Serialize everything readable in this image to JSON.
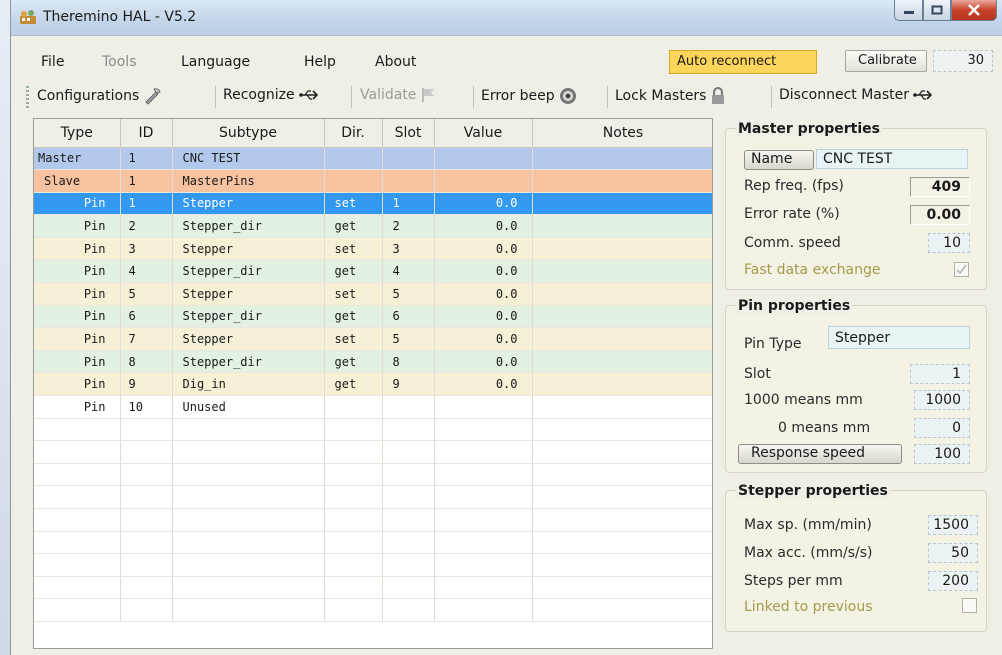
{
  "window": {
    "title": "Theremino HAL - V5.2"
  },
  "menu": {
    "file": "File",
    "tools": "Tools",
    "language": "Language",
    "help": "Help",
    "about": "About"
  },
  "top_right": {
    "auto_reconnect": "Auto reconnect",
    "calibrate": "Calibrate",
    "calibrate_value": "30"
  },
  "toolbar": {
    "configurations": "Configurations",
    "recognize": "Recognize",
    "validate": "Validate",
    "error_beep": "Error beep",
    "lock_masters": "Lock Masters",
    "disconnect_master": "Disconnect Master"
  },
  "grid": {
    "columns": [
      "Type",
      "ID",
      "Subtype",
      "Dir.",
      "Slot",
      "Value",
      "Notes"
    ],
    "rows": [
      {
        "type": "Master",
        "id": "1",
        "subtype": "CNC TEST",
        "dir": "",
        "slot": "",
        "value": "",
        "notes": "",
        "style": "master"
      },
      {
        "type": "Slave",
        "id": "1",
        "subtype": "MasterPins",
        "dir": "",
        "slot": "",
        "value": "",
        "notes": "",
        "style": "slave"
      },
      {
        "type": "Pin",
        "id": "1",
        "subtype": "Stepper",
        "dir": "set",
        "slot": "1",
        "value": "0.0",
        "notes": "",
        "style": "selected"
      },
      {
        "type": "Pin",
        "id": "2",
        "subtype": "Stepper_dir",
        "dir": "get",
        "slot": "2",
        "value": "0.0",
        "notes": "",
        "style": "alt-a"
      },
      {
        "type": "Pin",
        "id": "3",
        "subtype": "Stepper",
        "dir": "set",
        "slot": "3",
        "value": "0.0",
        "notes": "",
        "style": "alt-b"
      },
      {
        "type": "Pin",
        "id": "4",
        "subtype": "Stepper_dir",
        "dir": "get",
        "slot": "4",
        "value": "0.0",
        "notes": "",
        "style": "alt-a"
      },
      {
        "type": "Pin",
        "id": "5",
        "subtype": "Stepper",
        "dir": "set",
        "slot": "5",
        "value": "0.0",
        "notes": "",
        "style": "alt-b"
      },
      {
        "type": "Pin",
        "id": "6",
        "subtype": "Stepper_dir",
        "dir": "get",
        "slot": "6",
        "value": "0.0",
        "notes": "",
        "style": "alt-a"
      },
      {
        "type": "Pin",
        "id": "7",
        "subtype": "Stepper",
        "dir": "set",
        "slot": "5",
        "value": "0.0",
        "notes": "",
        "style": "alt-b"
      },
      {
        "type": "Pin",
        "id": "8",
        "subtype": "Stepper_dir",
        "dir": "get",
        "slot": "8",
        "value": "0.0",
        "notes": "",
        "style": "alt-a"
      },
      {
        "type": "Pin",
        "id": "9",
        "subtype": "Dig_in",
        "dir": "get",
        "slot": "9",
        "value": "0.0",
        "notes": "",
        "style": "alt-b"
      },
      {
        "type": "Pin",
        "id": "10",
        "subtype": "Unused",
        "dir": "",
        "slot": "",
        "value": "",
        "notes": "",
        "style": "empty"
      }
    ]
  },
  "master_props": {
    "title": "Master properties",
    "name_button": "Name",
    "name_value": "CNC TEST",
    "rep_freq_label": "Rep freq. (fps)",
    "rep_freq_value": "409",
    "error_rate_label": "Error rate (%)",
    "error_rate_value": "0.00",
    "comm_speed_label": "Comm. speed",
    "comm_speed_value": "10",
    "fast_exchange_label": "Fast data exchange",
    "fast_exchange_checked": true
  },
  "pin_props": {
    "title": "Pin properties",
    "pin_type_label": "Pin Type",
    "pin_type_value": "Stepper",
    "slot_label": "Slot",
    "slot_value": "1",
    "means_1000_label": "1000 means mm",
    "means_1000_value": "1000",
    "means_0_label": "0 means mm",
    "means_0_value": "0",
    "response_speed_button": "Response speed",
    "response_speed_value": "100"
  },
  "stepper_props": {
    "title": "Stepper properties",
    "max_speed_label": "Max sp. (mm/min)",
    "max_speed_value": "1500",
    "max_acc_label": "Max acc. (mm/s/s)",
    "max_acc_value": "50",
    "steps_per_mm_label": "Steps per mm",
    "steps_per_mm_value": "200",
    "linked_label": "Linked to previous",
    "linked_checked": false
  },
  "colors": {
    "master_row": "#b3c9ec",
    "slave_row": "#f7c2a0",
    "selected_row": "#3399ee",
    "auto_reconnect_bg": "#fcd55a"
  },
  "icons": {
    "app": "theremino-hal-icon",
    "configurations": "config-tools-icon",
    "recognize": "usb-icon",
    "validate": "flag-icon",
    "error_beep": "speaker-icon",
    "lock_masters": "lock-icon",
    "disconnect_master": "usb-icon"
  }
}
